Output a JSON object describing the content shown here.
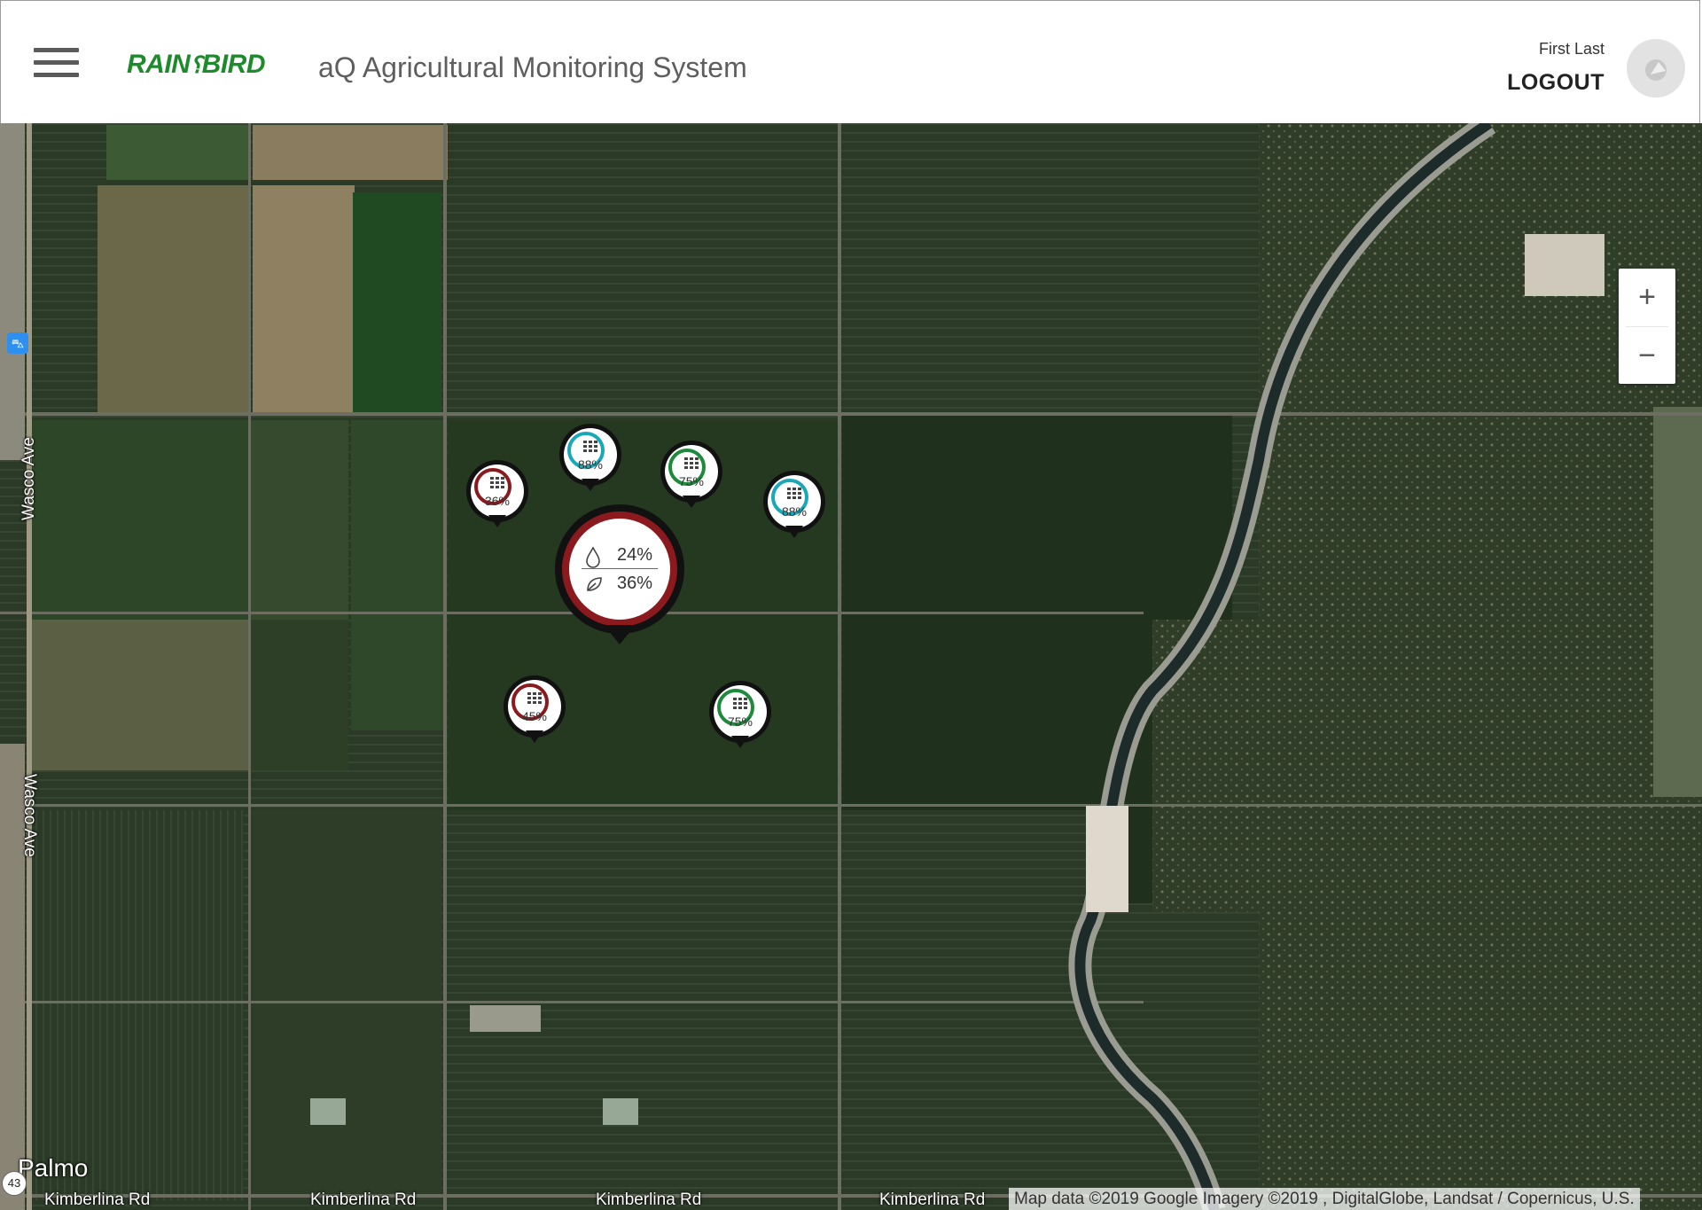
{
  "header": {
    "brand_main": "RAIN",
    "brand_second": "BIRD",
    "app_title": "aQ Agricultural Monitoring System",
    "user_name": "First Last",
    "logout_label": "LOGOUT"
  },
  "map": {
    "zoom_in_label": "+",
    "zoom_out_label": "−",
    "labels": {
      "wasco_ave_1": "Wasco Ave",
      "wasco_ave_2": "Wasco Ave",
      "palmo": "Palmo",
      "kimberlina_1": "Kimberlina Rd",
      "kimberlina_2": "Kimberlina Rd",
      "kimberlina_3": "Kimberlina Rd",
      "kimberlina_4": "Kimberlina Rd",
      "highway_43": "43"
    },
    "attribution": "Map data ©2019 Google Imagery ©2019 , DigitalGlobe, Landsat / Copernicus, U.S."
  },
  "markers": [
    {
      "value": "36%",
      "color": "#8a1a1e"
    },
    {
      "value": "88%",
      "color": "#1aa8b8"
    },
    {
      "value": "75%",
      "color": "#1e8a3c"
    },
    {
      "value": "88%",
      "color": "#1aa8b8"
    },
    {
      "value": "45%",
      "color": "#8a1a1e"
    },
    {
      "value": "75%",
      "color": "#1e8a3c"
    }
  ],
  "cluster": {
    "moisture_value": "24%",
    "health_value": "36%",
    "color": "#8a1a1e"
  },
  "colors": {
    "brand_green": "#1e8a2c",
    "alert_red": "#8a1a1e",
    "ok_green": "#1e8a3c",
    "info_teal": "#1aa8b8"
  }
}
